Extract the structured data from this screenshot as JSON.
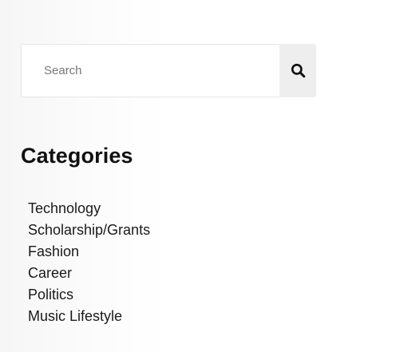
{
  "search": {
    "placeholder": "Search",
    "value": "",
    "button_icon": "search-icon"
  },
  "categories": {
    "title": "Categories",
    "items": [
      {
        "label": "Technology"
      },
      {
        "label": "Scholarship/Grants"
      },
      {
        "label": "Fashion"
      },
      {
        "label": "Career"
      },
      {
        "label": "Politics"
      },
      {
        "label": "Music Lifestyle"
      }
    ]
  },
  "colors": {
    "search_button_bg": "#eeeeee",
    "input_border": "#e6e6e6",
    "text": "#1a1a1a"
  }
}
